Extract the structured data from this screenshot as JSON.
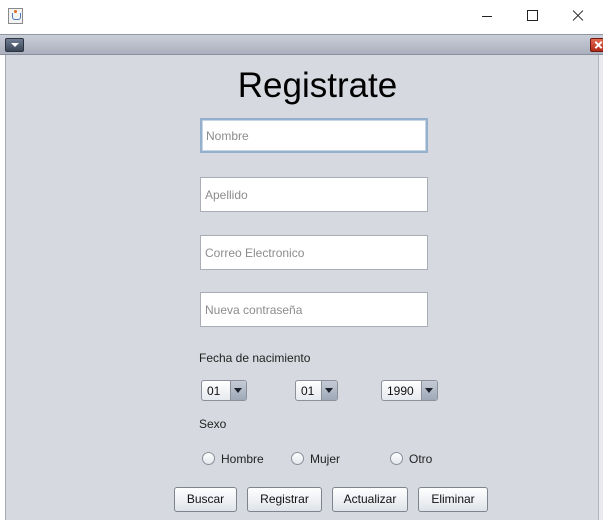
{
  "window": {
    "title": ""
  },
  "form": {
    "title": "Registrate",
    "fields": {
      "nombre": {
        "placeholder": "Nombre",
        "value": ""
      },
      "apellido": {
        "placeholder": "Apellido",
        "value": ""
      },
      "correo": {
        "placeholder": "Correo Electronico",
        "value": ""
      },
      "password": {
        "placeholder": "Nueva contraseña",
        "value": ""
      }
    },
    "birth_label": "Fecha de nacimiento",
    "birth": {
      "day": "01",
      "month": "01",
      "year": "1990"
    },
    "sex_label": "Sexo",
    "sex_options": [
      "Hombre",
      "Mujer",
      "Otro"
    ],
    "buttons": {
      "buscar": "Buscar",
      "registrar": "Registrar",
      "actualizar": "Actualizar",
      "eliminar": "Eliminar"
    }
  },
  "icons": {
    "app": "java-cup-icon",
    "menu": "chevron-down-icon",
    "close": "close-icon"
  },
  "colors": {
    "panel": "#d6d9df",
    "focus_border": "#94b0cc",
    "close_red": "#c0392b"
  }
}
